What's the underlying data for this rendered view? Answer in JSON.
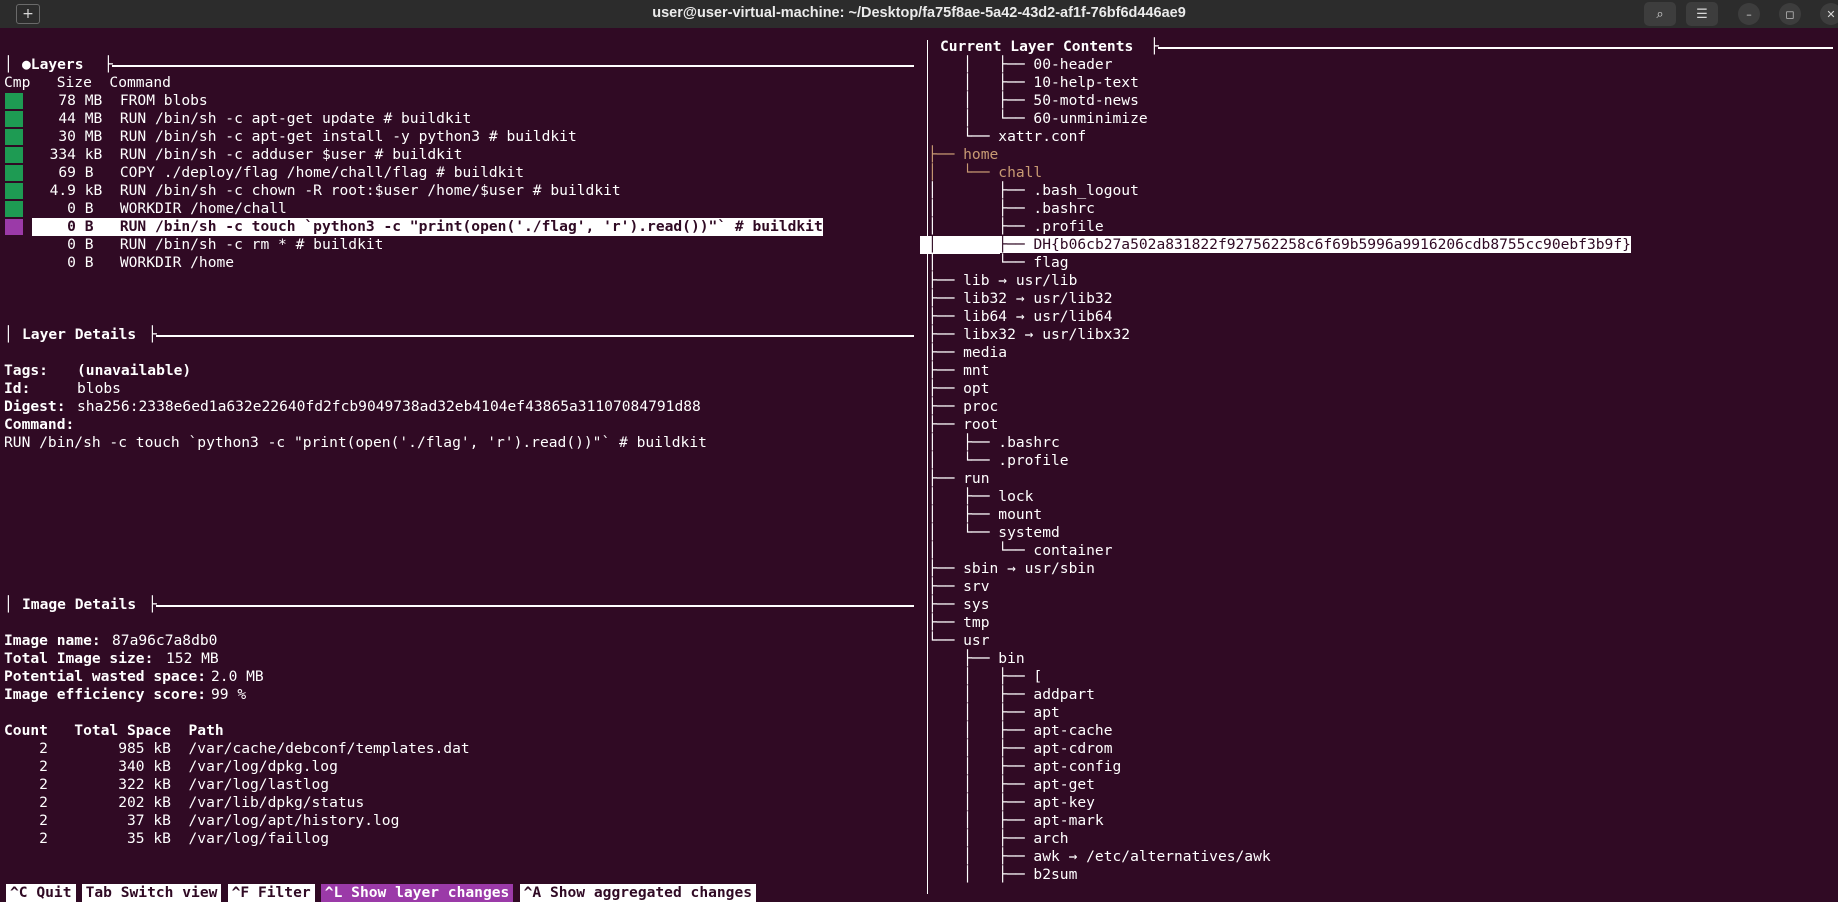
{
  "window": {
    "title": "user@user-virtual-machine: ~/Desktop/fa75f8ae-5a42-43d2-af1f-76bf6d446ae9",
    "new_tab_glyph": "+",
    "search_glyph": "⌕",
    "menu_glyph": "☰",
    "minimize_glyph": "–",
    "restore_glyph": "◻",
    "close_glyph": "✕"
  },
  "layers": {
    "title": "●Layers",
    "header": "Cmp   Size  Command",
    "rows": [
      {
        "text": "   78 MB  FROM blobs",
        "bar": "#1e9b53"
      },
      {
        "text": "   44 MB  RUN /bin/sh -c apt-get update # buildkit",
        "bar": "#1e9b53"
      },
      {
        "text": "   30 MB  RUN /bin/sh -c apt-get install -y python3 # buildkit",
        "bar": "#1e9b53"
      },
      {
        "text": "  334 kB  RUN /bin/sh -c adduser $user # buildkit",
        "bar": "#1e9b53"
      },
      {
        "text": "   69 B   COPY ./deploy/flag /home/chall/flag # buildkit",
        "bar": "#1e9b53"
      },
      {
        "text": "  4.9 kB  RUN /bin/sh -c chown -R root:$user /home/$user # buildkit",
        "bar": "#1e9b53"
      },
      {
        "text": "    0 B   WORKDIR /home/chall",
        "bar": "#1e9b53"
      },
      {
        "text": "    0 B   RUN /bin/sh -c touch `python3 -c \"print(open('./flag', 'r').read())\"` # buildkit",
        "bar": "#9b3aa8",
        "selected": true
      },
      {
        "text": "    0 B   RUN /bin/sh -c rm * # buildkit",
        "bar": ""
      },
      {
        "text": "    0 B   WORKDIR /home",
        "bar": ""
      }
    ]
  },
  "layer_details": {
    "title": "Layer Details",
    "tags_label": "Tags:",
    "tags_value": "(unavailable)",
    "id_label": "Id:",
    "id_value": "blobs",
    "digest_label": "Digest:",
    "digest_value": "sha256:2338e6ed1a632e22640fd2fcb9049738ad32eb4104ef43865a31107084791d88",
    "command_label": "Command:",
    "command_value": "RUN /bin/sh -c touch `python3 -c \"print(open('./flag', 'r').read())\"` # buildkit"
  },
  "image_details": {
    "title": "Image Details",
    "name_label": "Image name:",
    "name_value": "87a96c7a8db0",
    "size_label": "Total Image size:",
    "size_value": "152 MB",
    "wasted_label": "Potential wasted space:",
    "wasted_value": "2.0 MB",
    "efficiency_label": "Image efficiency score:",
    "efficiency_value": "99 %",
    "table_header": "Count   Total Space  Path",
    "rows": [
      "    2        985 kB  /var/cache/debconf/templates.dat",
      "    2        340 kB  /var/log/dpkg.log",
      "    2        322 kB  /var/log/lastlog",
      "    2        202 kB  /var/lib/dpkg/status",
      "    2         37 kB  /var/log/apt/history.log",
      "    2         35 kB  /var/log/faillog"
    ]
  },
  "contents": {
    "title": "Current Layer Contents",
    "rows": [
      {
        "text": "    │   ├── 00-header"
      },
      {
        "text": "    │   ├── 10-help-text"
      },
      {
        "text": "    │   ├── 50-motd-news"
      },
      {
        "text": "    │   └── 60-unminimize"
      },
      {
        "text": "    └── xattr.conf"
      },
      {
        "text": "├── home",
        "dim": true
      },
      {
        "text": "│   └── chall",
        "dim": true
      },
      {
        "text": "│       ├── .bash_logout"
      },
      {
        "text": "│       ├── .bashrc"
      },
      {
        "text": "│       ├── .profile"
      },
      {
        "text": "│       ├── DH{b06cb27a502a831822f927562258c6f69b5996a9916206cdb8755cc90ebf3b9f}",
        "selected": true
      },
      {
        "text": "│       └── flag"
      },
      {
        "text": "├── lib → usr/lib"
      },
      {
        "text": "├── lib32 → usr/lib32"
      },
      {
        "text": "├── lib64 → usr/lib64"
      },
      {
        "text": "├── libx32 → usr/libx32"
      },
      {
        "text": "├── media"
      },
      {
        "text": "├── mnt"
      },
      {
        "text": "├── opt"
      },
      {
        "text": "├── proc"
      },
      {
        "text": "├── root"
      },
      {
        "text": "│   ├── .bashrc"
      },
      {
        "text": "│   └── .profile"
      },
      {
        "text": "├── run"
      },
      {
        "text": "│   ├── lock"
      },
      {
        "text": "│   ├── mount"
      },
      {
        "text": "│   └── systemd"
      },
      {
        "text": "│       └── container"
      },
      {
        "text": "├── sbin → usr/sbin"
      },
      {
        "text": "├── srv"
      },
      {
        "text": "├── sys"
      },
      {
        "text": "├── tmp"
      },
      {
        "text": "└── usr"
      },
      {
        "text": "    ├── bin"
      },
      {
        "text": "    │   ├── ["
      },
      {
        "text": "    │   ├── addpart"
      },
      {
        "text": "    │   ├── apt"
      },
      {
        "text": "    │   ├── apt-cache"
      },
      {
        "text": "    │   ├── apt-cdrom"
      },
      {
        "text": "    │   ├── apt-config"
      },
      {
        "text": "    │   ├── apt-get"
      },
      {
        "text": "    │   ├── apt-key"
      },
      {
        "text": "    │   ├── apt-mark"
      },
      {
        "text": "    │   ├── arch"
      },
      {
        "text": "    │   ├── awk → /etc/alternatives/awk"
      },
      {
        "text": "    │   ├── b2sum"
      }
    ]
  },
  "status_bar": [
    {
      "text": "^C Quit",
      "bg": "#ffffff",
      "fg": "#300a24"
    },
    {
      "text": "Tab Switch view",
      "bg": "#ffffff",
      "fg": "#300a24"
    },
    {
      "text": "^F Filter",
      "bg": "#ffffff",
      "fg": "#300a24"
    },
    {
      "text": "^L Show layer changes",
      "bg": "#9b3aa8",
      "fg": "#ffffff"
    },
    {
      "text": "^A Show aggregated changes",
      "bg": "#ffffff",
      "fg": "#300a24"
    }
  ],
  "colors": {
    "background": "#300a24",
    "accent": "#9b3aa8",
    "bar_green": "#1e9b53",
    "dim_dir": "#c89a73"
  }
}
